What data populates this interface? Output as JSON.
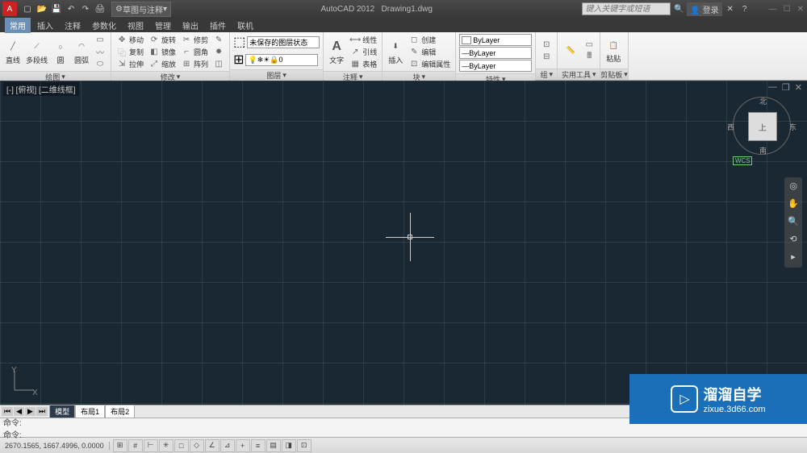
{
  "app": {
    "name": "AutoCAD 2012",
    "doc": "Drawing1.dwg"
  },
  "workspace": "草图与注释",
  "search_placeholder": "键入关键字或短语",
  "login": "登录",
  "menus": [
    "常用",
    "插入",
    "注释",
    "参数化",
    "视图",
    "管理",
    "输出",
    "插件",
    "联机"
  ],
  "ribbon": {
    "draw": {
      "title": "绘图",
      "line": "直线",
      "polyline": "多段线",
      "circle": "圆",
      "arc": "圆弧"
    },
    "modify": {
      "title": "修改",
      "r1": [
        "移动",
        "旋转",
        "修剪"
      ],
      "r2": [
        "复制",
        "镜像",
        "圆角"
      ],
      "r3": [
        "拉伸",
        "缩放",
        "阵列"
      ]
    },
    "layers": {
      "title": "图层",
      "state": "未保存的图层状态",
      "current": "0"
    },
    "annot": {
      "title": "注释",
      "text": "文字",
      "r1": "线性",
      "r2": "引线",
      "r3": "表格"
    },
    "block": {
      "title": "块",
      "insert": "插入",
      "r1": "创建",
      "r2": "编辑",
      "r3": "编辑属性"
    },
    "props": {
      "title": "特性",
      "l1": "ByLayer",
      "l2": "ByLayer",
      "l3": "ByLayer"
    },
    "groups": {
      "title": "组"
    },
    "utils": {
      "title": "实用工具"
    },
    "clip": {
      "title": "剪贴板",
      "paste": "粘贴"
    }
  },
  "viewport_label": "[-] [俯视] [二维线框]",
  "viewcube": {
    "top": "上",
    "n": "北",
    "s": "南",
    "e": "东",
    "w": "西",
    "wcs": "WCS"
  },
  "layout": {
    "model": "模型",
    "l1": "布局1",
    "l2": "布局2"
  },
  "cmd": {
    "history": "命令:",
    "prompt": "命令:"
  },
  "status": {
    "coords": "2670.1565, 1667.4996, 0.0000"
  },
  "watermark": {
    "brand": "溜溜自学",
    "url": "zixue.3d66.com"
  }
}
